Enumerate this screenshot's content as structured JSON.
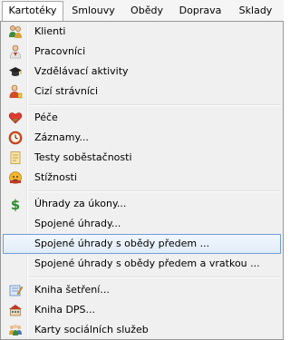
{
  "menubar": {
    "items": [
      {
        "label": "Kartotéky",
        "active": true
      },
      {
        "label": "Smlouvy",
        "active": false
      },
      {
        "label": "Obědy",
        "active": false
      },
      {
        "label": "Doprava",
        "active": false
      },
      {
        "label": "Sklady",
        "active": false
      }
    ]
  },
  "menu": {
    "items": [
      {
        "label": "Klienti",
        "icon": "people-icon"
      },
      {
        "label": "Pracovníci",
        "icon": "worker-icon"
      },
      {
        "label": "Vzdělávací aktivity",
        "icon": "graduation-cap-icon"
      },
      {
        "label": "Cizí strávníci",
        "icon": "diner-icon"
      },
      {
        "label": "Péče",
        "icon": "heart-icon"
      },
      {
        "label": "Záznamy...",
        "icon": "clock-icon"
      },
      {
        "label": "Testy soběstačnosti",
        "icon": "checklist-icon"
      },
      {
        "label": "Stížnosti",
        "icon": "complaint-icon"
      },
      {
        "label": "Úhrady za úkony...",
        "icon": "dollar-icon"
      },
      {
        "label": "Spojené úhrady...",
        "icon": ""
      },
      {
        "label": "Spojené úhrady s obědy předem ...",
        "icon": "",
        "highlighted": true
      },
      {
        "label": "Spojené úhrady s obědy předem a vratkou ...",
        "icon": ""
      },
      {
        "label": "Kniha šetření...",
        "icon": "notebook-icon"
      },
      {
        "label": "Kniha DPS...",
        "icon": "building-icon"
      },
      {
        "label": "Karty sociálních služeb",
        "icon": "cards-icon"
      }
    ]
  },
  "colors": {
    "highlight_border": "#6e9ed5",
    "highlight_fill": "#e1ecf9",
    "menu_background": "#f0f0f0"
  }
}
